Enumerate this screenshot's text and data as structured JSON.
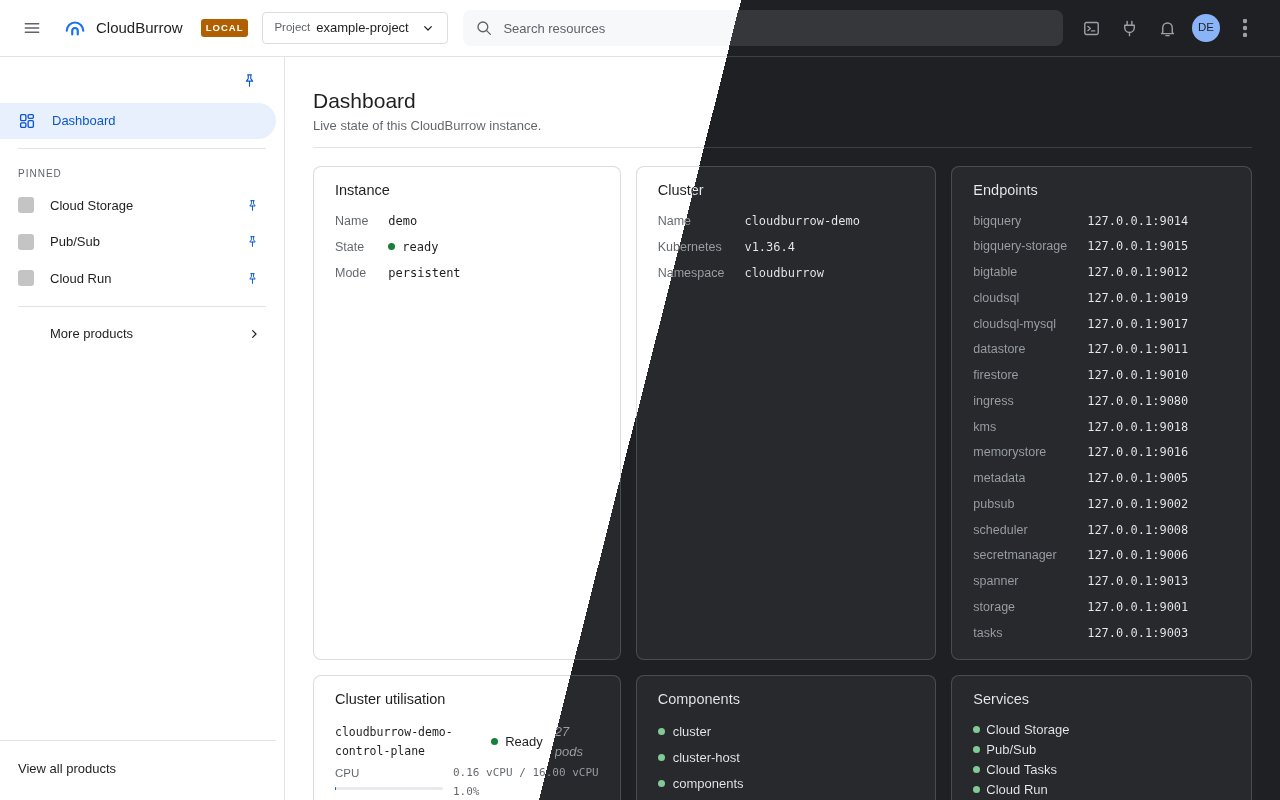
{
  "app": {
    "title": "CloudBurrow",
    "badge": "LOCAL"
  },
  "project_picker": {
    "label": "Project",
    "value": "example-project"
  },
  "search": {
    "placeholder": "Search resources"
  },
  "user": {
    "initials": "DE"
  },
  "sidebar": {
    "items": [
      {
        "label": "Dashboard",
        "selected": true
      }
    ],
    "pinned_heading": "PINNED",
    "pinned": [
      {
        "label": "Cloud Storage"
      },
      {
        "label": "Pub/Sub"
      },
      {
        "label": "Cloud Run"
      }
    ],
    "more": "More products",
    "footer_link": "View all products"
  },
  "page": {
    "title": "Dashboard",
    "subtitle": "Live state of this CloudBurrow instance."
  },
  "instance": {
    "title": "Instance",
    "fields": [
      {
        "label": "Name",
        "value": "demo"
      },
      {
        "label": "State",
        "value": "ready",
        "kind": "status"
      },
      {
        "label": "Mode",
        "value": "persistent"
      }
    ]
  },
  "cluster": {
    "title": "Cluster",
    "fields": [
      {
        "label": "Name",
        "value": "cloudburrow-demo"
      },
      {
        "label": "Kubernetes",
        "value": "v1.36.4"
      },
      {
        "label": "Namespace",
        "value": "cloudburrow"
      }
    ]
  },
  "endpoints": {
    "title": "Endpoints",
    "rows": [
      {
        "name": "bigquery",
        "address": "127.0.0.1:9014"
      },
      {
        "name": "bigquery-storage",
        "address": "127.0.0.1:9015"
      },
      {
        "name": "bigtable",
        "address": "127.0.0.1:9012"
      },
      {
        "name": "cloudsql",
        "address": "127.0.0.1:9019"
      },
      {
        "name": "cloudsql-mysql",
        "address": "127.0.0.1:9017"
      },
      {
        "name": "datastore",
        "address": "127.0.0.1:9011"
      },
      {
        "name": "firestore",
        "address": "127.0.0.1:9010"
      },
      {
        "name": "ingress",
        "address": "127.0.0.1:9080"
      },
      {
        "name": "kms",
        "address": "127.0.0.1:9018"
      },
      {
        "name": "memorystore",
        "address": "127.0.0.1:9016"
      },
      {
        "name": "metadata",
        "address": "127.0.0.1:9005"
      },
      {
        "name": "pubsub",
        "address": "127.0.0.1:9002"
      },
      {
        "name": "scheduler",
        "address": "127.0.0.1:9008"
      },
      {
        "name": "secretmanager",
        "address": "127.0.0.1:9006"
      },
      {
        "name": "spanner",
        "address": "127.0.0.1:9013"
      },
      {
        "name": "storage",
        "address": "127.0.0.1:9001"
      },
      {
        "name": "tasks",
        "address": "127.0.0.1:9003"
      }
    ]
  },
  "utilisation": {
    "title": "Cluster utilisation",
    "nodes": [
      {
        "name": "cloudburrow-demo-control-plane",
        "status": "Ready",
        "pods": "27 pods",
        "metrics": [
          {
            "label": "CPU",
            "reading": "0.16 vCPU / 16.00 vCPU",
            "level": 0.01,
            "percent": "1.0%"
          }
        ]
      }
    ]
  },
  "components": {
    "title": "Components",
    "items": [
      "cluster",
      "cluster-host",
      "components"
    ]
  },
  "services": {
    "title": "Services",
    "items": [
      "Cloud Storage",
      "Pub/Sub",
      "Cloud Tasks",
      "Cloud Run"
    ]
  }
}
